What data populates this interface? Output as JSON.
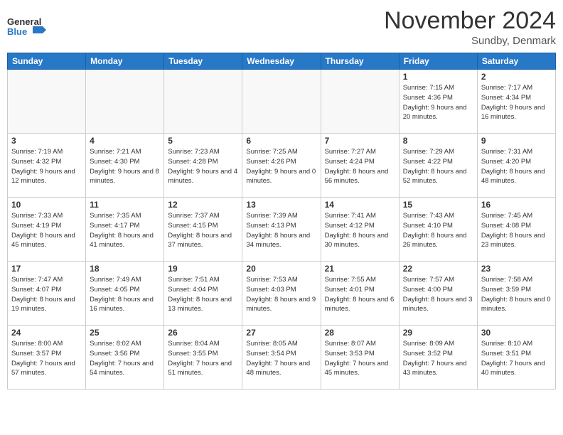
{
  "header": {
    "logo_general": "General",
    "logo_blue": "Blue",
    "month_title": "November 2024",
    "subtitle": "Sundby, Denmark"
  },
  "days_of_week": [
    "Sunday",
    "Monday",
    "Tuesday",
    "Wednesday",
    "Thursday",
    "Friday",
    "Saturday"
  ],
  "weeks": [
    [
      {
        "day": "",
        "info": ""
      },
      {
        "day": "",
        "info": ""
      },
      {
        "day": "",
        "info": ""
      },
      {
        "day": "",
        "info": ""
      },
      {
        "day": "",
        "info": ""
      },
      {
        "day": "1",
        "info": "Sunrise: 7:15 AM\nSunset: 4:36 PM\nDaylight: 9 hours and 20 minutes."
      },
      {
        "day": "2",
        "info": "Sunrise: 7:17 AM\nSunset: 4:34 PM\nDaylight: 9 hours and 16 minutes."
      }
    ],
    [
      {
        "day": "3",
        "info": "Sunrise: 7:19 AM\nSunset: 4:32 PM\nDaylight: 9 hours and 12 minutes."
      },
      {
        "day": "4",
        "info": "Sunrise: 7:21 AM\nSunset: 4:30 PM\nDaylight: 9 hours and 8 minutes."
      },
      {
        "day": "5",
        "info": "Sunrise: 7:23 AM\nSunset: 4:28 PM\nDaylight: 9 hours and 4 minutes."
      },
      {
        "day": "6",
        "info": "Sunrise: 7:25 AM\nSunset: 4:26 PM\nDaylight: 9 hours and 0 minutes."
      },
      {
        "day": "7",
        "info": "Sunrise: 7:27 AM\nSunset: 4:24 PM\nDaylight: 8 hours and 56 minutes."
      },
      {
        "day": "8",
        "info": "Sunrise: 7:29 AM\nSunset: 4:22 PM\nDaylight: 8 hours and 52 minutes."
      },
      {
        "day": "9",
        "info": "Sunrise: 7:31 AM\nSunset: 4:20 PM\nDaylight: 8 hours and 48 minutes."
      }
    ],
    [
      {
        "day": "10",
        "info": "Sunrise: 7:33 AM\nSunset: 4:19 PM\nDaylight: 8 hours and 45 minutes."
      },
      {
        "day": "11",
        "info": "Sunrise: 7:35 AM\nSunset: 4:17 PM\nDaylight: 8 hours and 41 minutes."
      },
      {
        "day": "12",
        "info": "Sunrise: 7:37 AM\nSunset: 4:15 PM\nDaylight: 8 hours and 37 minutes."
      },
      {
        "day": "13",
        "info": "Sunrise: 7:39 AM\nSunset: 4:13 PM\nDaylight: 8 hours and 34 minutes."
      },
      {
        "day": "14",
        "info": "Sunrise: 7:41 AM\nSunset: 4:12 PM\nDaylight: 8 hours and 30 minutes."
      },
      {
        "day": "15",
        "info": "Sunrise: 7:43 AM\nSunset: 4:10 PM\nDaylight: 8 hours and 26 minutes."
      },
      {
        "day": "16",
        "info": "Sunrise: 7:45 AM\nSunset: 4:08 PM\nDaylight: 8 hours and 23 minutes."
      }
    ],
    [
      {
        "day": "17",
        "info": "Sunrise: 7:47 AM\nSunset: 4:07 PM\nDaylight: 8 hours and 19 minutes."
      },
      {
        "day": "18",
        "info": "Sunrise: 7:49 AM\nSunset: 4:05 PM\nDaylight: 8 hours and 16 minutes."
      },
      {
        "day": "19",
        "info": "Sunrise: 7:51 AM\nSunset: 4:04 PM\nDaylight: 8 hours and 13 minutes."
      },
      {
        "day": "20",
        "info": "Sunrise: 7:53 AM\nSunset: 4:03 PM\nDaylight: 8 hours and 9 minutes."
      },
      {
        "day": "21",
        "info": "Sunrise: 7:55 AM\nSunset: 4:01 PM\nDaylight: 8 hours and 6 minutes."
      },
      {
        "day": "22",
        "info": "Sunrise: 7:57 AM\nSunset: 4:00 PM\nDaylight: 8 hours and 3 minutes."
      },
      {
        "day": "23",
        "info": "Sunrise: 7:58 AM\nSunset: 3:59 PM\nDaylight: 8 hours and 0 minutes."
      }
    ],
    [
      {
        "day": "24",
        "info": "Sunrise: 8:00 AM\nSunset: 3:57 PM\nDaylight: 7 hours and 57 minutes."
      },
      {
        "day": "25",
        "info": "Sunrise: 8:02 AM\nSunset: 3:56 PM\nDaylight: 7 hours and 54 minutes."
      },
      {
        "day": "26",
        "info": "Sunrise: 8:04 AM\nSunset: 3:55 PM\nDaylight: 7 hours and 51 minutes."
      },
      {
        "day": "27",
        "info": "Sunrise: 8:05 AM\nSunset: 3:54 PM\nDaylight: 7 hours and 48 minutes."
      },
      {
        "day": "28",
        "info": "Sunrise: 8:07 AM\nSunset: 3:53 PM\nDaylight: 7 hours and 45 minutes."
      },
      {
        "day": "29",
        "info": "Sunrise: 8:09 AM\nSunset: 3:52 PM\nDaylight: 7 hours and 43 minutes."
      },
      {
        "day": "30",
        "info": "Sunrise: 8:10 AM\nSunset: 3:51 PM\nDaylight: 7 hours and 40 minutes."
      }
    ]
  ]
}
